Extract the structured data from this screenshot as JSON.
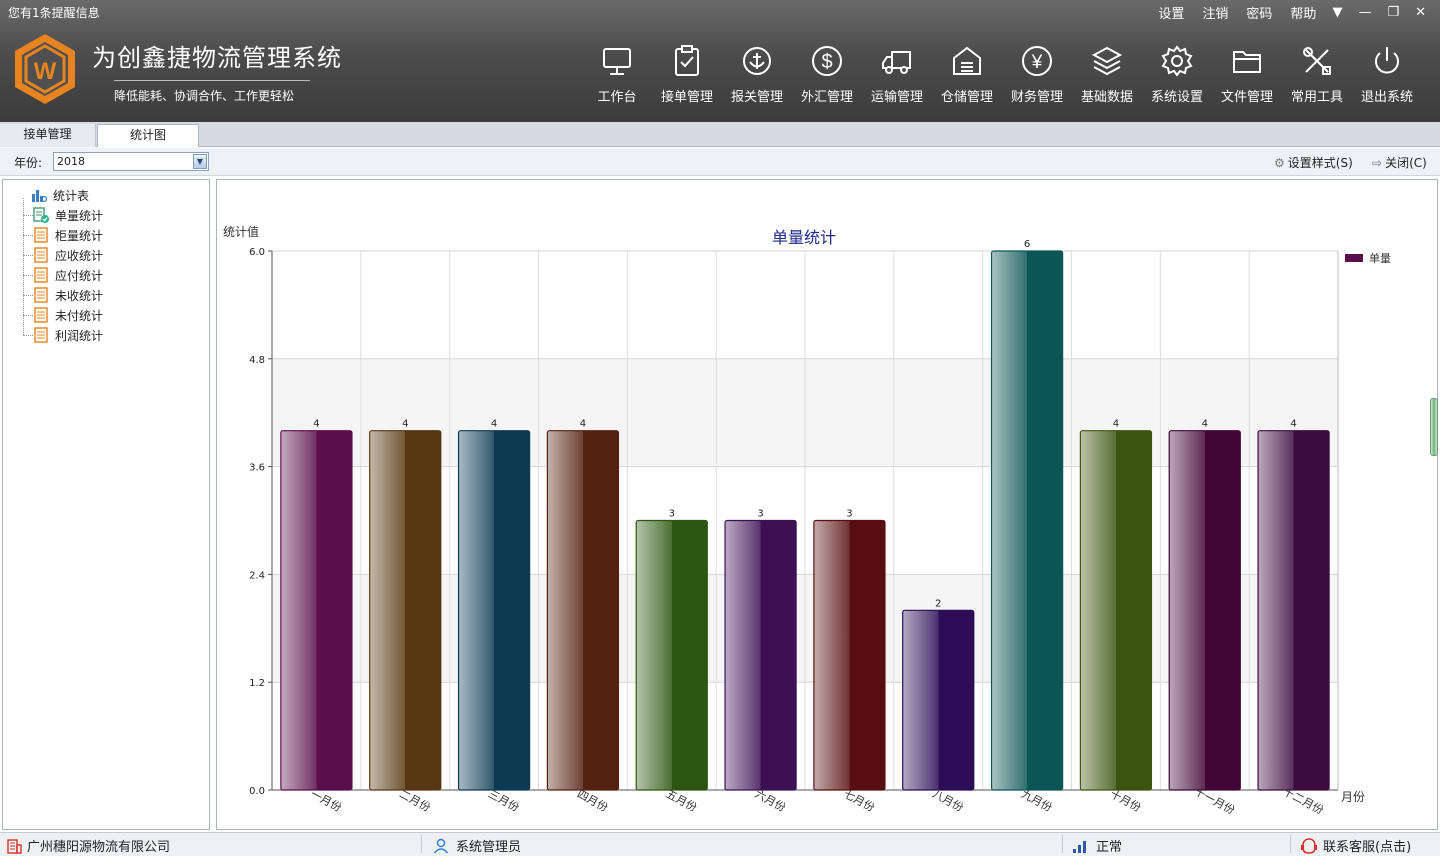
{
  "header": {
    "notice": "您有1条提醒信息",
    "app_title": "为创鑫捷物流管理系统",
    "app_subtitle": "降低能耗、协调合作、工作更轻松",
    "top_links": [
      "设置",
      "注销",
      "密码",
      "帮助"
    ],
    "nav": [
      {
        "label": "工作台",
        "icon": "monitor-icon"
      },
      {
        "label": "接单管理",
        "icon": "clipboard-check-icon"
      },
      {
        "label": "报关管理",
        "icon": "anchor-icon"
      },
      {
        "label": "外汇管理",
        "icon": "dollar-icon"
      },
      {
        "label": "运输管理",
        "icon": "truck-icon"
      },
      {
        "label": "仓储管理",
        "icon": "warehouse-icon"
      },
      {
        "label": "财务管理",
        "icon": "yen-icon"
      },
      {
        "label": "基础数据",
        "icon": "layers-icon"
      },
      {
        "label": "系统设置",
        "icon": "gear-icon"
      },
      {
        "label": "文件管理",
        "icon": "folder-icon"
      },
      {
        "label": "常用工具",
        "icon": "tools-icon"
      },
      {
        "label": "退出系统",
        "icon": "power-icon"
      }
    ]
  },
  "tabs": [
    {
      "label": "接单管理",
      "active": false
    },
    {
      "label": "统计图",
      "active": true
    }
  ],
  "toolbar": {
    "year_label": "年份:",
    "year_value": "2018",
    "style_button": "设置样式(S)",
    "close_button": "关闭(C)"
  },
  "tree": {
    "root": "统计表",
    "items": [
      "单量统计",
      "柜量统计",
      "应收统计",
      "应付统计",
      "未收统计",
      "未付统计",
      "利润统计"
    ]
  },
  "chart_data": {
    "type": "bar",
    "title": "单量统计",
    "ylabel": "统计值",
    "xlabel": "月份",
    "categories": [
      "一月份",
      "二月份",
      "三月份",
      "四月份",
      "五月份",
      "六月份",
      "七月份",
      "八月份",
      "九月份",
      "十月份",
      "十一月份",
      "十二月份"
    ],
    "series": [
      {
        "name": "单量",
        "values": [
          4,
          4,
          4,
          4,
          3,
          3,
          3,
          2,
          6,
          4,
          4,
          4
        ]
      }
    ],
    "yticks": [
      "0.0",
      "1.2",
      "2.4",
      "3.6",
      "4.8",
      "6.0"
    ],
    "ylim": [
      0,
      6
    ],
    "grid": true,
    "legend_position": "top-right",
    "bar_colors": [
      "#5a0e4c",
      "#573711",
      "#0d3a53",
      "#552111",
      "#2d5710",
      "#3d1055",
      "#580f11",
      "#2c0d56",
      "#0c5555",
      "#3b5510",
      "#420536",
      "#3c0c3f"
    ],
    "legend_color": "#5a0e4c"
  },
  "status": {
    "company": "广州穗阳源物流有限公司",
    "user": "系统管理员",
    "connection": "正常",
    "support": "联系客服(点击)"
  }
}
